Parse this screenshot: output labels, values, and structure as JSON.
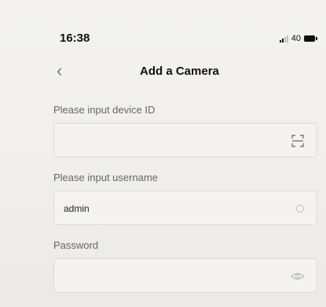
{
  "status": {
    "time": "16:38",
    "battery": "40"
  },
  "nav": {
    "title": "Add a Camera",
    "back": "‹"
  },
  "form": {
    "device_id": {
      "label": "Please input device ID",
      "value": ""
    },
    "username": {
      "label": "Please input username",
      "value": "admin"
    },
    "password": {
      "label": "Password",
      "value": ""
    }
  },
  "icons": {
    "scan": "scan-icon",
    "clear": "clear-icon",
    "visibility": "eye-icon"
  }
}
